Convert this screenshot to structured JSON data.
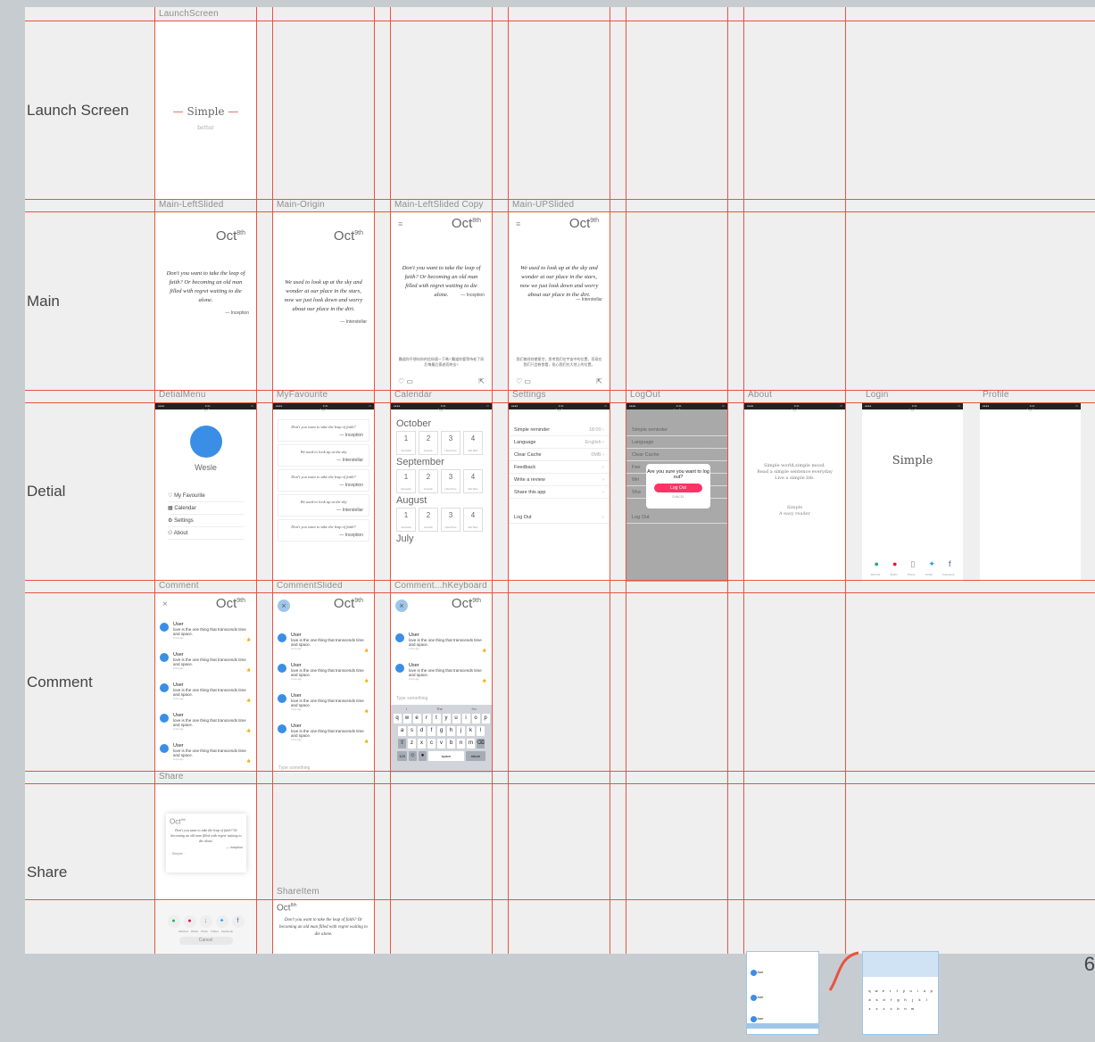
{
  "rows": [
    {
      "name": "launch",
      "label": "Launch Screen"
    },
    {
      "name": "main",
      "label": "Main"
    },
    {
      "name": "detail",
      "label": "Detial"
    },
    {
      "name": "comment",
      "label": "Comment"
    },
    {
      "name": "share",
      "label": "Share"
    }
  ],
  "artboards": {
    "launch": "LaunchScreen",
    "main_leftslided": "Main-LeftSlided",
    "main_origin": "Main-Origin",
    "main_leftslided_copy": "Main-LeftSlided Copy",
    "main_upslided": "Main-UPSlided",
    "detial_menu": "DetialMenu",
    "my_favourite": "MyFavourite",
    "calendar": "Calendar",
    "settings": "Settings",
    "logout": "LogOut",
    "about": "About",
    "login": "Login",
    "profile": "Profile",
    "comment": "Comment",
    "comment_slided": "CommentSlided",
    "comment_keyboard": "Comment...hKeyboard",
    "share": "Share",
    "share_item": "ShareItem"
  },
  "launch_screen": {
    "title": "Simple",
    "subtitle": "better"
  },
  "main": {
    "month": "Oct",
    "day_8": "8th",
    "day_9": "9th",
    "quote_inception": "Don't you want to take the leap of faith? Or becoming an old man filled with regret waiting to die alone.",
    "attr_inception": "— Inception",
    "quote_interstellar": "We used to look up at the sky and wonder at our place in the stars, now we just look down and worry about our place in the dirt.",
    "attr_interstellar": "— Interstellar",
    "cn_inception": "難道你不想向你的信仰邁一下嗎? 難道你要等待老了再后悔最后孤老而終去?",
    "cn_interstellar": "我们曾经仰望星空，思考我们在宇宙中的位置，而现在我们只会俯首看，担心我们在大地上的位置。"
  },
  "detail_menu": {
    "name": "Wesle",
    "items": [
      {
        "icon": "♡",
        "label": "My Favourite"
      },
      {
        "icon": "▦",
        "label": "Calendar"
      },
      {
        "icon": "⚙",
        "label": "Settings"
      },
      {
        "icon": "⚇",
        "label": "About"
      }
    ]
  },
  "favourites": [
    {
      "quote": "Don't you want to take the leap of faith?",
      "attr": "— Inception"
    },
    {
      "quote": "We used to look up at the sky",
      "attr": "— Interstellar"
    },
    {
      "quote": "Don't you want to take the leap of faith?",
      "attr": "— Inception"
    },
    {
      "quote": "We used to look up at the sky",
      "attr": "— Interstellar"
    },
    {
      "quote": "Don't you want to take the leap of faith?",
      "attr": "— Inception"
    }
  ],
  "calendar": {
    "months": [
      "October",
      "September",
      "August",
      "July"
    ],
    "day_labels": [
      "1",
      "2",
      "3",
      "4"
    ],
    "day_subs": [
      "Interstellar",
      "Inception",
      "Little Prince",
      "Star Wars"
    ]
  },
  "settings": {
    "rows": [
      {
        "label": "Simple reminder",
        "value": "18:00 ›"
      },
      {
        "label": "Language",
        "value": "English ›"
      },
      {
        "label": "Clear Cache",
        "value": "0MB ›"
      },
      {
        "label": "Feedback",
        "value": "›"
      },
      {
        "label": "Write a review",
        "value": "›"
      },
      {
        "label": "Share this app",
        "value": "›"
      }
    ],
    "logout_label": "Log Out"
  },
  "logout_dialog": {
    "question": "Are you sure you want to log out?",
    "button": "Log Out",
    "cancel": "CANCEL",
    "short_rows": [
      "Fee",
      "Wri",
      "Sha"
    ]
  },
  "about": {
    "line1": "Simple world,simple mood.",
    "line2": "Read a simple sentence everyday",
    "line3": "Live a simple life.",
    "line4": "Simple",
    "line5": "A easy reader"
  },
  "login": {
    "title": "Simple",
    "providers": [
      "WeChat",
      "Weibo",
      "Phone",
      "Twitter",
      "Facebook"
    ]
  },
  "comments": {
    "user": "User",
    "text": "love is the one thing that transcends time and space.",
    "time": "1mins ago",
    "like": "👍",
    "placeholder": "Type something",
    "close": "×"
  },
  "keyboard": {
    "suggest": [
      "I",
      "The",
      "I'm"
    ],
    "row1": [
      "q",
      "w",
      "e",
      "r",
      "t",
      "y",
      "u",
      "i",
      "o",
      "p"
    ],
    "row2": [
      "a",
      "s",
      "d",
      "f",
      "g",
      "h",
      "j",
      "k",
      "l"
    ],
    "row3": [
      "z",
      "x",
      "c",
      "v",
      "b",
      "n",
      "m"
    ],
    "num": "123",
    "space": "space",
    "return": "return"
  },
  "share": {
    "quote": "Don't you want to take the leap of faith? Or becoming an old man filled with regret waiting to die alone.",
    "attr": "— Inception",
    "brand": "· Simple ·",
    "providers": [
      "WeChat",
      "Weibo",
      "Photo",
      "Twitter",
      "Facebook"
    ],
    "cancel": "Cancel"
  },
  "page_number": "6",
  "colors": {
    "grid": "#e8543f",
    "accent": "#3a8ee6",
    "danger": "#ff3366"
  }
}
